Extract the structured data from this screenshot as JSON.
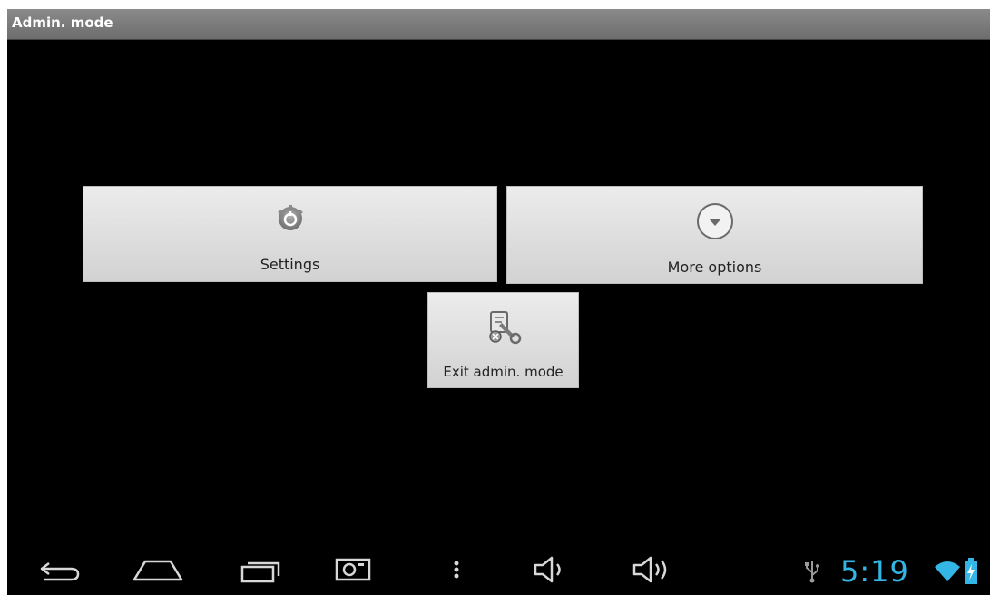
{
  "window": {
    "title": "Admin. mode"
  },
  "tiles": {
    "settings": {
      "label": "Settings",
      "icon": "gear-icon"
    },
    "more_options": {
      "label": "More options",
      "icon": "chevron-down-circle-icon"
    },
    "exit_admin": {
      "label": "Exit admin. mode",
      "icon": "wrench-icon"
    }
  },
  "nav": {
    "back": "back-icon",
    "home": "home-icon",
    "recent": "recent-apps-icon",
    "screenshot": "camera-icon",
    "menu": "menu-icon",
    "volume_down": "volume-down-icon",
    "volume_up": "volume-up-icon"
  },
  "status": {
    "time": "5:19",
    "usb": "usb-icon",
    "wifi": "wifi-icon",
    "battery": "battery-charging-icon",
    "accent_color": "#33b5e5"
  }
}
